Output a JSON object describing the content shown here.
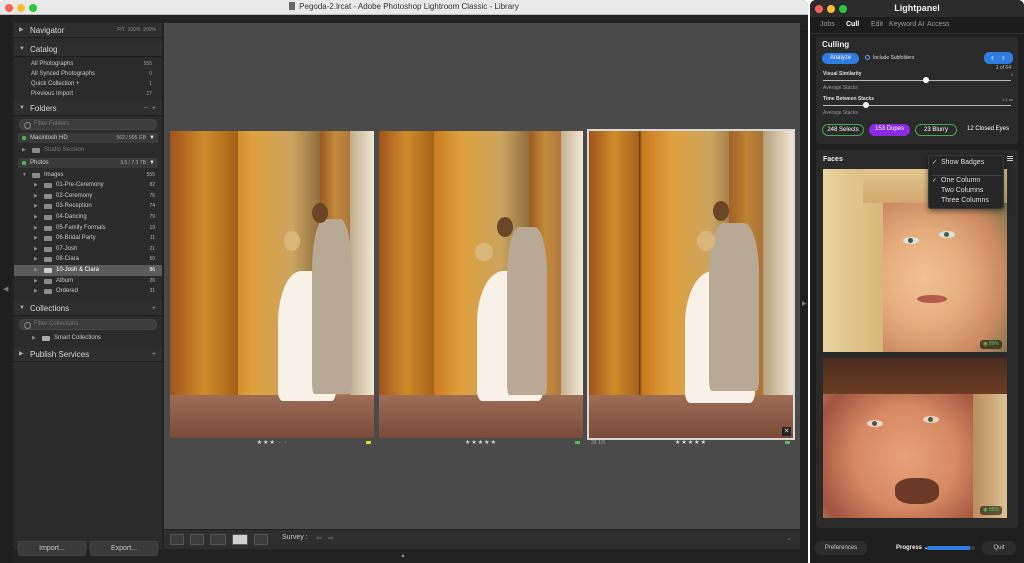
{
  "window": {
    "title": "Pegoda-2.lrcat - Adobe Photoshop Lightroom Classic - Library"
  },
  "left_panel": {
    "navigator": {
      "label": "Navigator",
      "zoom_options": [
        "FIT",
        "100%",
        "200%"
      ]
    },
    "catalog": {
      "label": "Catalog",
      "items": [
        {
          "label": "All Photographs",
          "count": "555"
        },
        {
          "label": "All Synced Photographs",
          "count": "0"
        },
        {
          "label": "Quick Collection +",
          "count": "1"
        },
        {
          "label": "Previous Import",
          "count": "17"
        }
      ]
    },
    "folders": {
      "label": "Folders",
      "search_placeholder": "Filter Folders",
      "volumes": [
        {
          "label": "Macintosh HD",
          "info": "562 / 995 GB"
        },
        {
          "label": "Photos",
          "info": "3.5 / 7.3 TB"
        }
      ],
      "studio_session": "Studio Session",
      "images": {
        "label": "Images",
        "count": "555"
      },
      "items": [
        {
          "label": "01-Pre-Ceremony",
          "count": "82"
        },
        {
          "label": "02-Ceremony",
          "count": "76"
        },
        {
          "label": "03-Reception",
          "count": "74"
        },
        {
          "label": "04-Dancing",
          "count": "79"
        },
        {
          "label": "05-Family Formals",
          "count": "19"
        },
        {
          "label": "06-Bridal Party",
          "count": "11"
        },
        {
          "label": "07-Josh",
          "count": "21"
        },
        {
          "label": "08-Ciara",
          "count": "50"
        },
        {
          "label": "10-Josh & Ciara",
          "count": "86"
        },
        {
          "label": "Album",
          "count": "26"
        },
        {
          "label": "Ordered",
          "count": "31"
        }
      ]
    },
    "collections": {
      "label": "Collections",
      "search_placeholder": "Filter Collections",
      "smart": "Smart Collections"
    },
    "publish": {
      "label": "Publish Services"
    },
    "import_label": "Import...",
    "export_label": "Export..."
  },
  "grid": {
    "photos": [
      {
        "stars": "★★★ · ·",
        "flag_color": "#e5d431"
      },
      {
        "stars": "★★★★★",
        "flag_color": "#4fbf4a"
      },
      {
        "stars": "★★★★★",
        "flag_color": "#4fbf4a",
        "selected": true,
        "info": "33 1/3"
      }
    ]
  },
  "toolbar": {
    "survey_label": "Survey :"
  },
  "lightpanel": {
    "title": "Lightpanel",
    "tabs": [
      "Jobs",
      "Cull",
      "Edit",
      "Keyword AI",
      "Access"
    ],
    "active_tab": "Cull",
    "culling": {
      "title": "Culling",
      "analyze_label": "Analyze",
      "include_subfolders": "Include Subfolders",
      "page_count": "1 of 64",
      "visual_similarity": {
        "label": "Visual Similarity",
        "sub": "Average Stacks",
        "value": "2"
      },
      "time_between": {
        "label": "Time Between Stacks",
        "sub": "Average Stacks",
        "value": "0.1 ss"
      },
      "pills": [
        {
          "label": "248 Selects",
          "color": "#3fae4a"
        },
        {
          "label": "153 Dupes",
          "color": "#8a2be2"
        },
        {
          "label": "23 Blurry",
          "color": "#3fae4a"
        },
        {
          "label": "12 Closed Eyes",
          "color": "#2a2a2a"
        }
      ]
    },
    "faces": {
      "title": "Faces",
      "menu": {
        "show_badges": "Show Badges",
        "options": [
          "One Column",
          "Two Columns",
          "Three Columns"
        ],
        "checked": "One Column"
      },
      "badges": [
        "89%",
        "85%"
      ]
    },
    "bottom": {
      "preferences_label": "Preferences",
      "progress_label": "Progress",
      "progress_value": 0.9,
      "quit_label": "Quit"
    }
  },
  "colors": {
    "accent": "#2f7de0",
    "lr_panel": "#2b2b2b",
    "grid_bg": "#4a4a4a"
  }
}
